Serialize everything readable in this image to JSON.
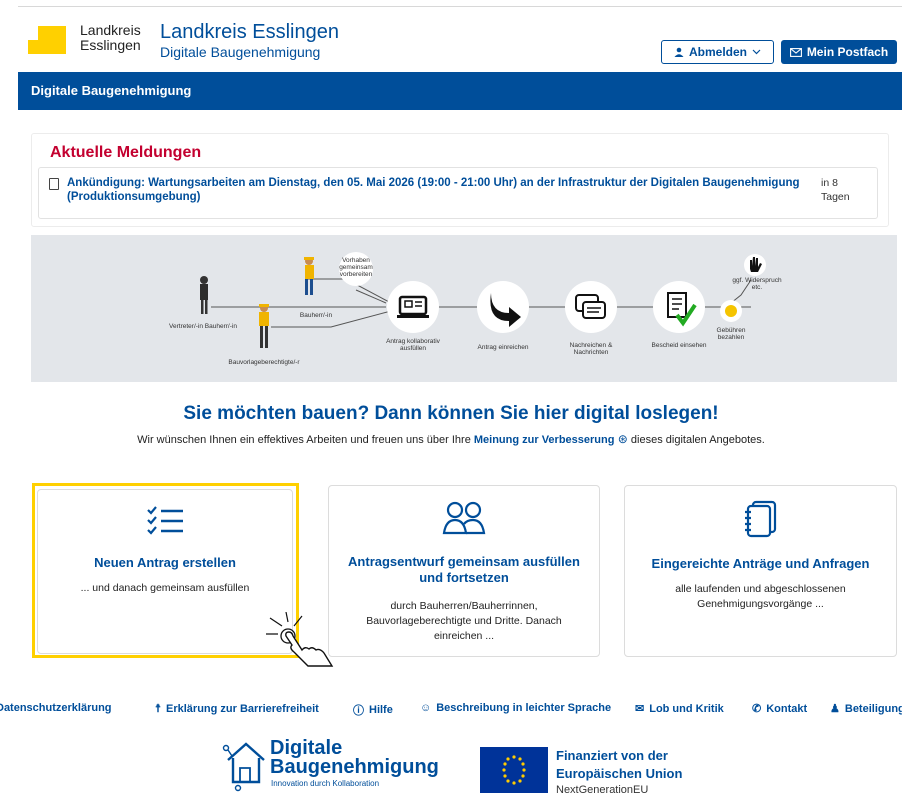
{
  "header": {
    "logo_text_line1": "Landkreis",
    "logo_text_line2": "Esslingen",
    "title": "Landkreis Esslingen",
    "subtitle": "Digitale Baugenehmigung",
    "logout_label": "Abmelden",
    "postfach_label": "Mein Postfach"
  },
  "nav": {
    "title": "Digitale Baugenehmigung"
  },
  "news": {
    "heading": "Aktuelle Meldungen",
    "item_text": "Ankündigung: Wartungsarbeiten am Dienstag, den 05. Mai 2026 (19:00 - 21:00 Uhr) an der Infrastruktur der Digitalen Baugenehmigung (Produktionsumgebung)",
    "item_when_1": "in 8",
    "item_when_2": "Tagen"
  },
  "process": {
    "vertreter": "Vertreter/-in Bauherr/-in",
    "bauherr": "Bauherr/-in",
    "bauvorlage": "Bauvorlageberechtigte/-r",
    "vorhaben": "Vorhaben gemeinsam vorbereiten",
    "step1": "Antrag kollaborativ ausfüllen",
    "step2": "Antrag einreichen",
    "step3": "Nachreichen & Nachrichten",
    "step4": "Bescheid einsehen",
    "gebuehren": "Gebühren bezahlen",
    "widerspruch": "ggf. Widerspruch etc."
  },
  "intro": {
    "headline": "Sie möchten bauen? Dann können Sie hier digital loslegen!",
    "text_before": "Wir wünschen Ihnen ein effektives Arbeiten und freuen uns über Ihre ",
    "link": "Meinung zur Verbesserung",
    "text_after": " dieses digitalen Angebotes."
  },
  "cards": [
    {
      "title": "Neuen Antrag erstellen",
      "desc": "... und danach gemeinsam ausfüllen",
      "icon": "list-icon"
    },
    {
      "title": "Antragsentwurf gemeinsam ausfüllen und fortsetzen",
      "desc": "durch Bauherren/Bauherrinnen, Bauvorlageberechtigte und Dritte. Danach einreichen ...",
      "icon": "users-icon"
    },
    {
      "title": "Eingereichte Anträge und Anfragen",
      "desc": "alle laufenden und abgeschlossenen Genehmigungsvorgänge ...",
      "icon": "documents-icon"
    }
  ],
  "footer": {
    "links": [
      "Datenschutzerklärung",
      "Erklärung zur Barrierefreiheit",
      "Hilfe",
      "Beschreibung in leichter Sprache",
      "Lob und Kritik",
      "Kontakt",
      "Beteiligung"
    ],
    "logo_line1": "Digitale",
    "logo_line2": "Baugenehmigung",
    "logo_tagline": "Innovation durch Kollaboration",
    "eu_line1": "Finanziert von der",
    "eu_line2": "Europäischen Union",
    "eu_line3": "NextGenerationEU"
  },
  "colors": {
    "primary": "#004e9a",
    "accent": "#ffd000",
    "alert": "#c3002f"
  }
}
